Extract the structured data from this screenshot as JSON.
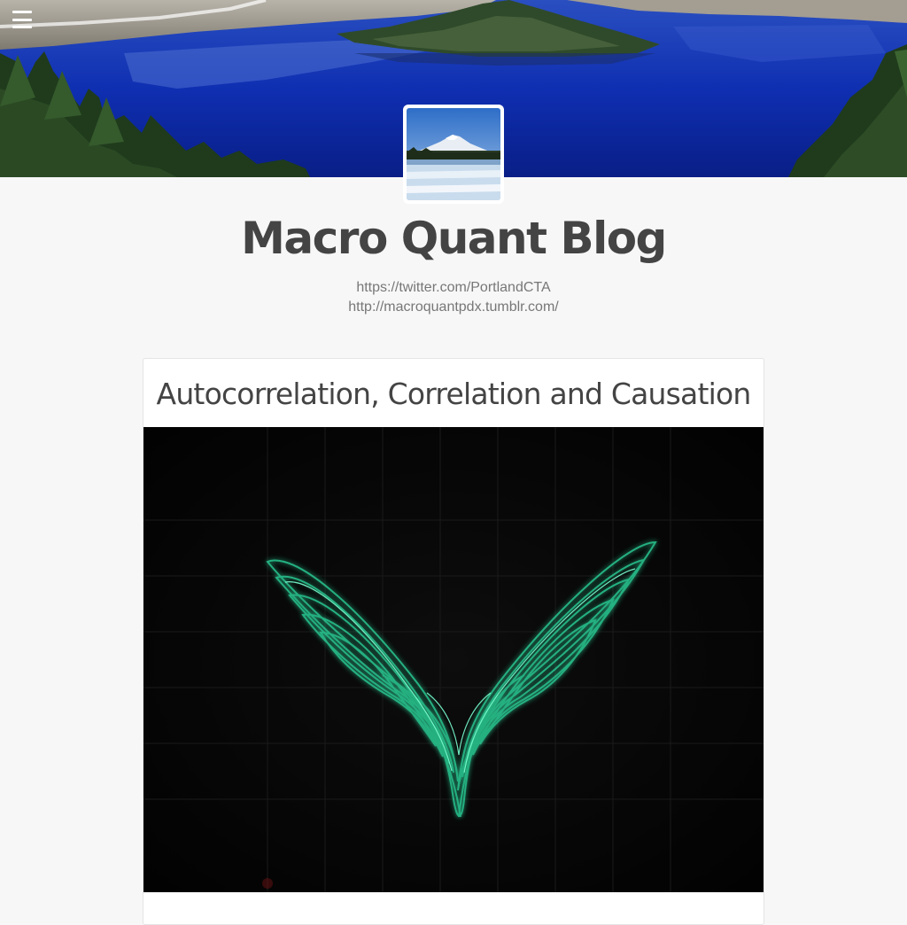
{
  "header": {
    "menu_icon": "hamburger-menu-icon",
    "banner_image": "lake-with-island-and-pine-trees",
    "avatar_image": "snow-capped-mountain-over-frozen-lake"
  },
  "blog": {
    "title": "Macro Quant Blog",
    "links": [
      "https://twitter.com/PortlandCTA",
      "http://macroquantpdx.tumblr.com/"
    ]
  },
  "post": {
    "title": "Autocorrelation, Correlation and Causation",
    "image": "green-lorenz-attractor-on-oscilloscope"
  },
  "colors": {
    "page_background": "#f7f7f7",
    "title_text": "#444444",
    "link_text": "#777777",
    "attractor_green": "#2ee8a8"
  }
}
